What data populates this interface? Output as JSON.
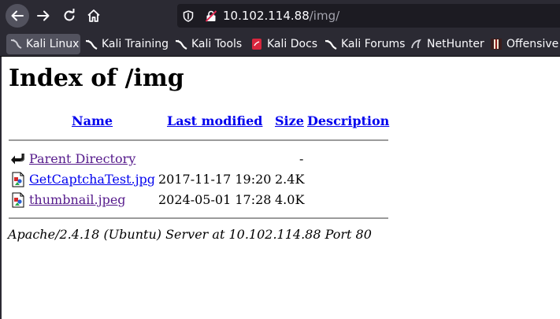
{
  "browser": {
    "url_host": "10.102.114.88",
    "url_path": "/img/",
    "bookmarks": [
      {
        "label": "Kali Linux",
        "icon": "kali-dragon-icon"
      },
      {
        "label": "Kali Training",
        "icon": "kali-dragon-icon"
      },
      {
        "label": "Kali Tools",
        "icon": "kali-dragon-icon"
      },
      {
        "label": "Kali Docs",
        "icon": "kali-docs-icon"
      },
      {
        "label": "Kali Forums",
        "icon": "kali-dragon-icon"
      },
      {
        "label": "NetHunter",
        "icon": "nethunter-icon"
      },
      {
        "label": "Offensive S",
        "icon": "offsec-icon"
      }
    ]
  },
  "page": {
    "title": "Index of /img",
    "columns": {
      "name": "Name",
      "last_modified": "Last modified",
      "size": "Size",
      "description": "Description"
    },
    "rows": [
      {
        "name": "Parent Directory",
        "modified": "",
        "size": "-",
        "icon": "back-arrow-icon"
      },
      {
        "name": "GetCaptchaTest.jpg",
        "modified": "2017-11-17 19:20",
        "size": "2.4K",
        "icon": "image-file-icon"
      },
      {
        "name": "thumbnail.jpeg",
        "modified": "2024-05-01 17:28",
        "size": "4.0K",
        "icon": "image-file-icon"
      }
    ],
    "footer": "Apache/2.4.18 (Ubuntu) Server at 10.102.114.88 Port 80"
  },
  "colors": {
    "chrome_bg": "#2b2a33",
    "urlbar_bg": "#1c1b22",
    "link": "#0000ee",
    "visited_link": "#551a8b"
  }
}
